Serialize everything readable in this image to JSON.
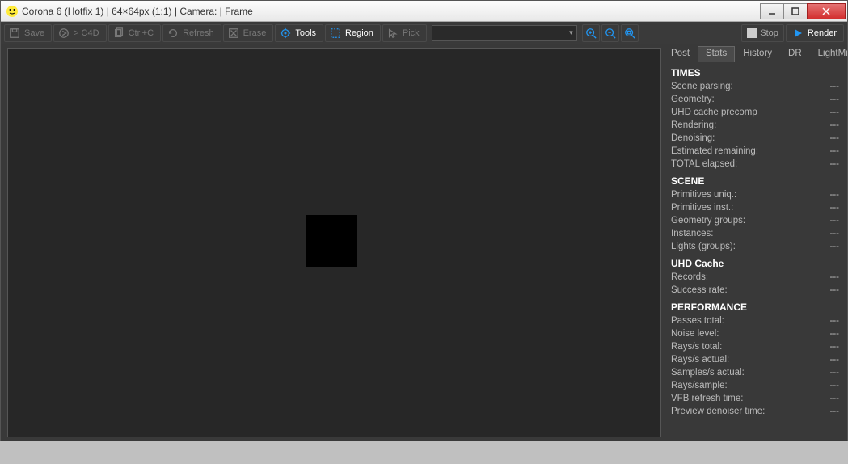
{
  "title": "Corona 6 (Hotfix 1) | 64×64px (1:1) | Camera:  | Frame",
  "toolbar": {
    "save": "Save",
    "c4d": "> C4D",
    "ctrlc": "Ctrl+C",
    "refresh": "Refresh",
    "erase": "Erase",
    "tools": "Tools",
    "region": "Region",
    "pick": "Pick",
    "stop": "Stop",
    "render": "Render"
  },
  "tabs": [
    "Post",
    "Stats",
    "History",
    "DR",
    "LightMix"
  ],
  "activeTab": 1,
  "sections": [
    {
      "title": "TIMES",
      "rows": [
        {
          "k": "Scene parsing:",
          "v": "---"
        },
        {
          "k": "Geometry:",
          "v": "---"
        },
        {
          "k": "UHD cache precomp",
          "v": "---"
        },
        {
          "k": "Rendering:",
          "v": "---"
        },
        {
          "k": "Denoising:",
          "v": "---"
        },
        {
          "k": "Estimated remaining:",
          "v": "---"
        },
        {
          "k": "TOTAL elapsed:",
          "v": "---"
        }
      ]
    },
    {
      "title": "SCENE",
      "rows": [
        {
          "k": "Primitives uniq.:",
          "v": "---"
        },
        {
          "k": "Primitives inst.:",
          "v": "---"
        },
        {
          "k": "Geometry groups:",
          "v": "---"
        },
        {
          "k": "Instances:",
          "v": "---"
        },
        {
          "k": "Lights (groups):",
          "v": "---"
        }
      ]
    },
    {
      "title": "UHD Cache",
      "rows": [
        {
          "k": "Records:",
          "v": "---"
        },
        {
          "k": "Success rate:",
          "v": "---"
        }
      ]
    },
    {
      "title": "PERFORMANCE",
      "rows": [
        {
          "k": "Passes total:",
          "v": "---"
        },
        {
          "k": "Noise level:",
          "v": "---"
        },
        {
          "k": "Rays/s total:",
          "v": "---"
        },
        {
          "k": "Rays/s actual:",
          "v": "---"
        },
        {
          "k": "Samples/s actual:",
          "v": "---"
        },
        {
          "k": "Rays/sample:",
          "v": "---"
        },
        {
          "k": "VFB refresh time:",
          "v": "---"
        },
        {
          "k": "Preview denoiser time:",
          "v": "---"
        }
      ]
    }
  ]
}
